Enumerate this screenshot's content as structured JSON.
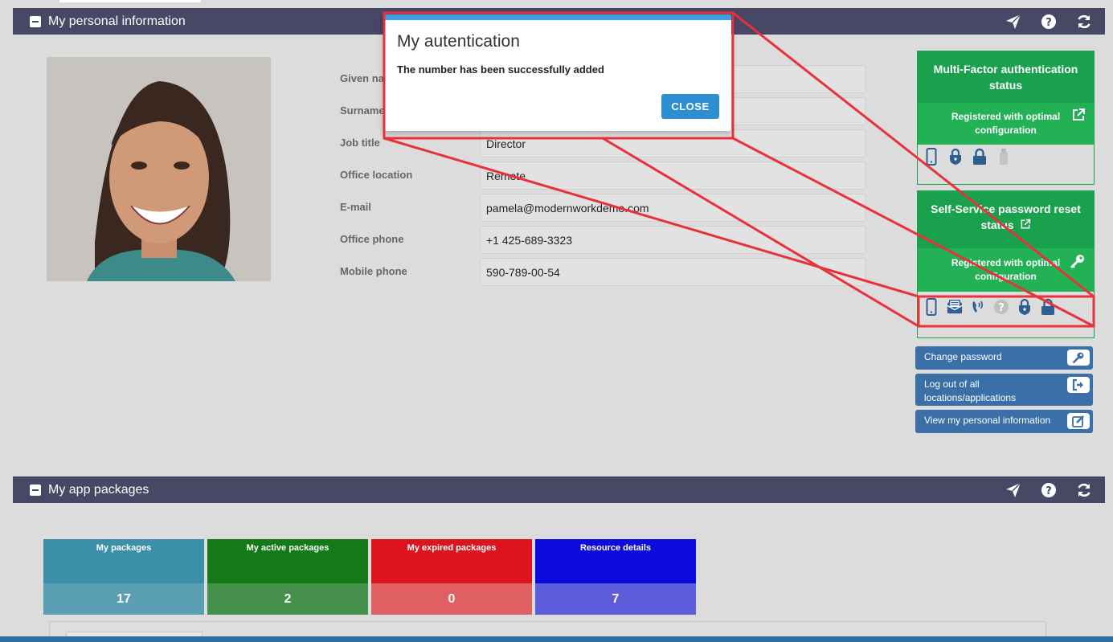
{
  "personal_panel": {
    "title": "My personal information",
    "fields": [
      {
        "label": "Given name",
        "value": ""
      },
      {
        "label": "Surname",
        "value": ""
      },
      {
        "label": "Job title",
        "value": "Director"
      },
      {
        "label": "Office location",
        "value": "Remote"
      },
      {
        "label": "E-mail",
        "value": "pamela@modernworkdemo.com"
      },
      {
        "label": "Office phone",
        "value": "+1 425-689-3323"
      },
      {
        "label": "Mobile phone",
        "value": "590-789-00-54"
      }
    ]
  },
  "mfa_card": {
    "title": "Multi-Factor authentication status",
    "status": "Registered with optimal configuration"
  },
  "sspr_card": {
    "title": "Self-Service password reset status",
    "status": "Registered with optimal configuration"
  },
  "actions": {
    "change_password": "Change password",
    "logout_all": "Log out of all locations/applications",
    "view_info": "View my personal information"
  },
  "apps_panel": {
    "title": "My app packages",
    "tiles": [
      {
        "label": "My packages",
        "value": "17"
      },
      {
        "label": "My active packages",
        "value": "2"
      },
      {
        "label": "My expired packages",
        "value": "0"
      },
      {
        "label": "Resource details",
        "value": "7"
      }
    ]
  },
  "modal": {
    "title": "My autentication",
    "message": "The number has been successfully added",
    "close_label": "CLOSE"
  },
  "colors": {
    "header": "#474766",
    "green": "#1aa14d",
    "button_blue": "#3a6fa7",
    "highlight_red": "#e8313a",
    "tile_packages": "#3b8fa8",
    "tile_active": "#137a17",
    "tile_expired": "#dd141e",
    "tile_resource": "#0b0bde"
  }
}
